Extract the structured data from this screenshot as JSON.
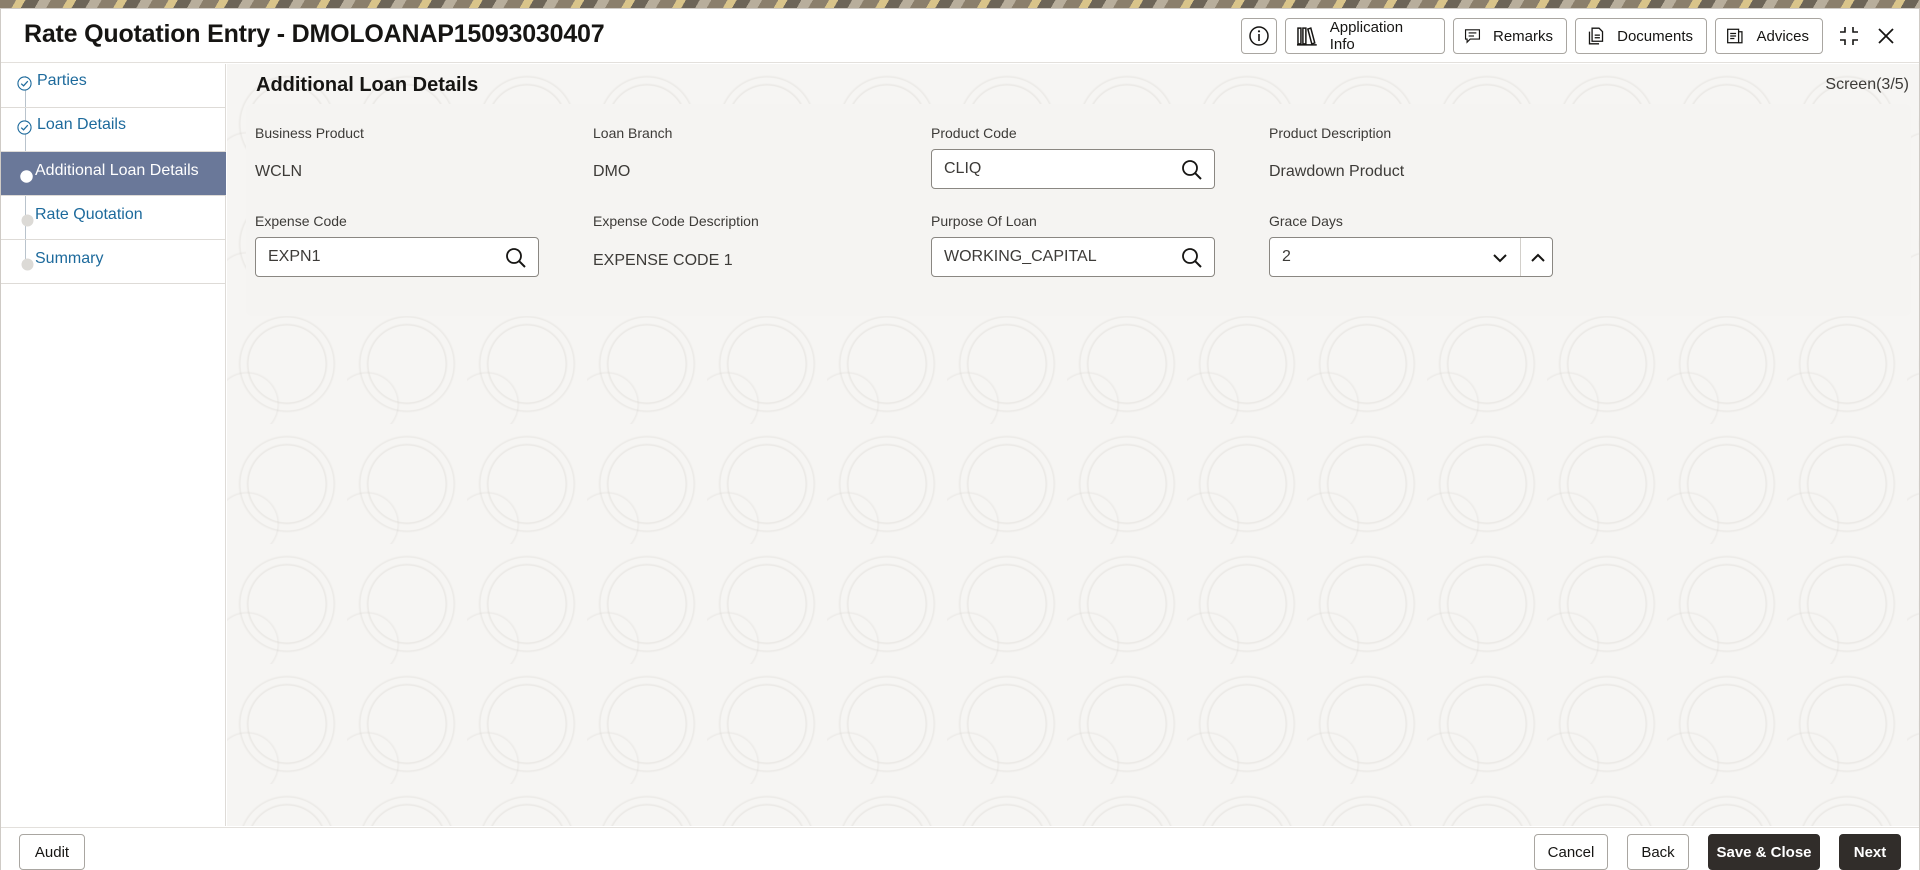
{
  "header": {
    "title": "Rate Quotation Entry - DMOLOANAP15093030407",
    "buttons": {
      "application_info": "Application Info",
      "remarks": "Remarks",
      "documents": "Documents",
      "advices": "Advices"
    }
  },
  "sidebar": {
    "items": [
      {
        "label": "Parties",
        "state": "completed"
      },
      {
        "label": "Loan Details",
        "state": "completed"
      },
      {
        "label": "Additional Loan Details",
        "state": "active"
      },
      {
        "label": "Rate Quotation",
        "state": "pending"
      },
      {
        "label": "Summary",
        "state": "pending"
      }
    ]
  },
  "main": {
    "section_title": "Additional Loan Details",
    "screen_indicator": "Screen(3/5)",
    "fields": {
      "business_product": {
        "label": "Business Product",
        "value": "WCLN"
      },
      "loan_branch": {
        "label": "Loan Branch",
        "value": "DMO"
      },
      "product_code": {
        "label": "Product Code",
        "value": "CLIQ"
      },
      "product_description": {
        "label": "Product Description",
        "value": "Drawdown Product"
      },
      "expense_code": {
        "label": "Expense Code",
        "value": "EXPN1"
      },
      "expense_code_description": {
        "label": "Expense Code Description",
        "value": "EXPENSE CODE 1"
      },
      "purpose_of_loan": {
        "label": "Purpose Of Loan",
        "value": "WORKING_CAPITAL"
      },
      "grace_days": {
        "label": "Grace Days",
        "value": "2"
      }
    }
  },
  "footer": {
    "audit": "Audit",
    "cancel": "Cancel",
    "back": "Back",
    "save_close": "Save & Close",
    "next": "Next"
  },
  "colors": {
    "active_nav": "#6a7899",
    "link": "#1d6a9c",
    "primary_button": "#312d2a"
  }
}
